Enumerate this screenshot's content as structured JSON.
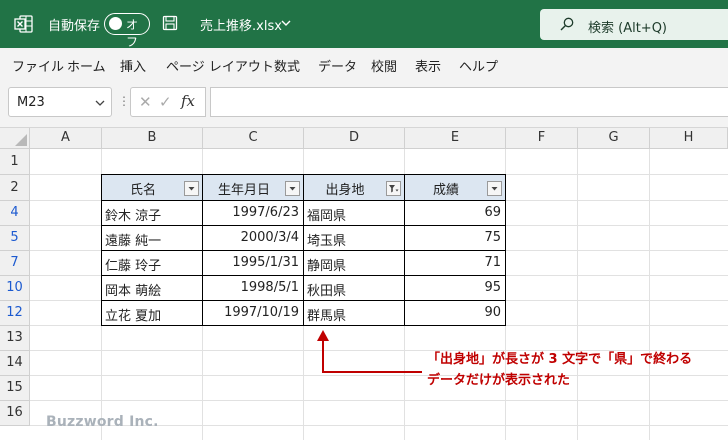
{
  "titlebar": {
    "autosave_label": "自動保存",
    "toggle_label": "オフ",
    "filename": "売上推移.xlsx",
    "search_placeholder": "検索 (Alt+Q)"
  },
  "menu": [
    "ファイル",
    "ホーム",
    "挿入",
    "ページ レイアウト",
    "数式",
    "データ",
    "校閲",
    "表示",
    "ヘルプ"
  ],
  "formula_bar": {
    "name_box": "M23",
    "fx_label": "fx",
    "formula": ""
  },
  "sheet": {
    "columns": [
      "A",
      "B",
      "C",
      "D",
      "E",
      "F",
      "G",
      "H"
    ],
    "rows": [
      "1",
      "2",
      "4",
      "5",
      "7",
      "10",
      "12",
      "13",
      "14",
      "15",
      "16"
    ],
    "filtered_rows": [
      "4",
      "5",
      "7",
      "10",
      "12"
    ],
    "headers": [
      "氏名",
      "生年月日",
      "出身地",
      "成績"
    ],
    "data": [
      [
        "鈴木 涼子",
        "1997/6/23",
        "福岡県",
        "69"
      ],
      [
        "遠藤 純一",
        "2000/3/4",
        "埼玉県",
        "75"
      ],
      [
        "仁藤 玲子",
        "1995/1/31",
        "静岡県",
        "71"
      ],
      [
        "岡本 萌絵",
        "1998/5/1",
        "秋田県",
        "95"
      ],
      [
        "立花 夏加",
        "1997/10/19",
        "群馬県",
        "90"
      ]
    ]
  },
  "annotation": {
    "line1": "「出身地」が長さが 3 文字で「県」で終わる",
    "line2": "データだけが表示された",
    "color": "#c00000"
  },
  "watermark": "Buzzword Inc.",
  "colors": {
    "titlebar": "#217346",
    "header_fill": "#dce6f1",
    "filtered_row_number": "#1c5ad0"
  }
}
